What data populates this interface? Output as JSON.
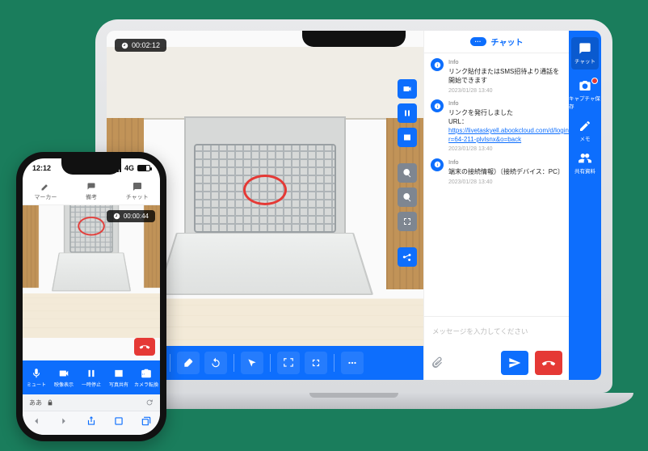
{
  "laptop": {
    "timer": "00:02:12",
    "chat": {
      "header_pill": "···",
      "header": "チャット",
      "input_placeholder": "メッセージを入力してください",
      "messages": [
        {
          "name": "Info",
          "text": "リンク貼付またはSMS招待より通話を開始できます",
          "time": "2023/01/28 13:40"
        },
        {
          "name": "Info",
          "html": "リンクを発行しました<br>URL：<span class='link'>https://livetaskyell.abookcloud.com/d/login?r=64-211-plvlsnx&o=back</span>",
          "time": "2023/01/28 13:40"
        },
        {
          "name": "Info",
          "text": "端末の接続情報）〔接続デバイス：PC〕",
          "time": "2023/01/28 13:40"
        }
      ]
    },
    "rail": [
      {
        "key": "chat",
        "label": "チャット"
      },
      {
        "key": "capture",
        "label": "キャプチャ保存",
        "badge": true
      },
      {
        "key": "memo",
        "label": "メモ"
      },
      {
        "key": "members",
        "label": "共有資料"
      }
    ]
  },
  "phone": {
    "clock": "12:12",
    "network_label": "4G",
    "tabs": [
      {
        "key": "marker",
        "label": "マーカー"
      },
      {
        "key": "note",
        "label": "備考"
      },
      {
        "key": "chat",
        "label": "チャット"
      }
    ],
    "timer": "00:00:44",
    "controls": [
      {
        "key": "mute",
        "label": "ミュート"
      },
      {
        "key": "video",
        "label": "映像表示"
      },
      {
        "key": "pause",
        "label": "一時停止"
      },
      {
        "key": "photo",
        "label": "写真共有"
      },
      {
        "key": "switch",
        "label": "カメラ転換"
      }
    ],
    "url_hint": "ああ",
    "url_host": " "
  }
}
